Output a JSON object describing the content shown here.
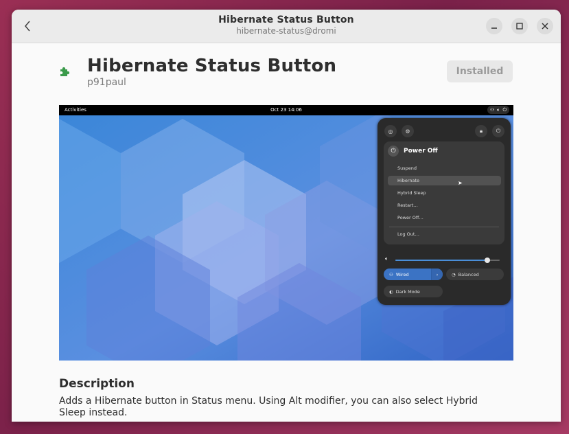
{
  "window": {
    "title": "Hibernate Status Button",
    "subtitle": "hibernate-status@dromi",
    "back_icon": "chevron-left-icon",
    "minimize_icon": "minimize-icon",
    "maximize_icon": "maximize-icon",
    "close_icon": "close-icon"
  },
  "extension": {
    "name": "Hibernate Status Button",
    "author": "p91paul",
    "icon": "puzzle-piece-icon",
    "icon_color": "#3a9a4a",
    "install_state": "Installed"
  },
  "screenshot": {
    "topbar": {
      "activities": "Activities",
      "clock": "Oct 23  14:06",
      "status_icons": [
        "network-icon",
        "volume-icon",
        "power-icon"
      ]
    },
    "menu": {
      "top_buttons": [
        "screenshot-icon",
        "settings-icon",
        "lock-icon",
        "power-icon"
      ],
      "power_title": "Power Off",
      "items": [
        "Suspend",
        "Hibernate",
        "Hybrid Sleep",
        "Restart…",
        "Power Off…",
        "Log Out…"
      ],
      "highlighted_item": "Hibernate",
      "volume_level": 0.88,
      "toggles": {
        "wired": "Wired",
        "balanced": "Balanced",
        "dark_mode": "Dark Mode"
      }
    }
  },
  "description": {
    "heading": "Description",
    "text": "Adds a Hibernate button in Status menu. Using Alt modifier, you can also select Hybrid Sleep instead."
  }
}
